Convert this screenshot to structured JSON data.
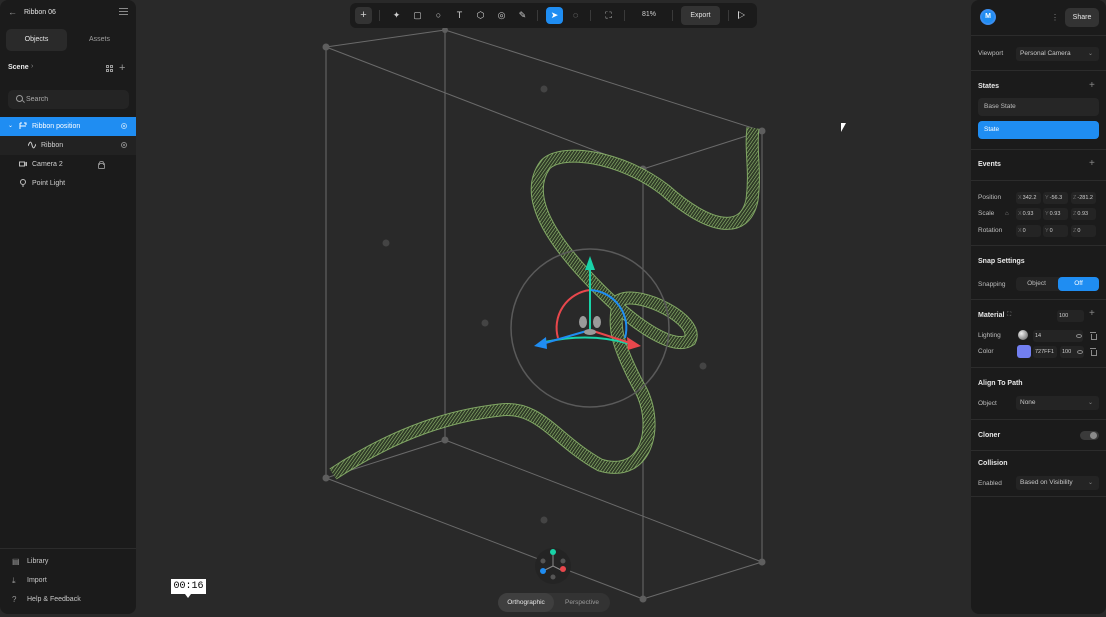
{
  "project": {
    "title": "Ribbon 06"
  },
  "left_panel": {
    "tabs": [
      {
        "label": "Objects"
      },
      {
        "label": "Assets"
      }
    ],
    "scene_label": "Scene",
    "search_placeholder": "Search",
    "layers": [
      {
        "name": "Ribbon position",
        "icon": "group-icon"
      },
      {
        "name": "Ribbon",
        "icon": "path-icon"
      },
      {
        "name": "Camera 2",
        "icon": "camera-icon"
      },
      {
        "name": "Point Light",
        "icon": "lightbulb-icon"
      }
    ],
    "footer": [
      {
        "label": "Library",
        "icon": "library-icon"
      },
      {
        "label": "Import",
        "icon": "import-icon"
      },
      {
        "label": "Help & Feedback",
        "icon": "help-icon"
      }
    ]
  },
  "toolbar": {
    "zoom": "81%",
    "export_label": "Export"
  },
  "right_panel": {
    "avatar_initial": "M",
    "share_label": "Share",
    "viewport_label": "Viewport",
    "viewport_value": "Personal Camera",
    "states_title": "States",
    "states": [
      "Base State",
      "State"
    ],
    "events_title": "Events",
    "position_label": "Position",
    "position": {
      "x": "342.2",
      "y": "-56.3",
      "z": "-281.2"
    },
    "scale_label": "Scale",
    "scale": {
      "x": "0.93",
      "y": "0.93",
      "z": "0.93"
    },
    "rotation_label": "Rotation",
    "rotation": {
      "x": "0",
      "y": "0",
      "z": "0"
    },
    "snap_title": "Snap Settings",
    "snapping_label": "Snapping",
    "snapping_options": [
      "Object",
      "Off"
    ],
    "material_title": "Material",
    "material_opacity": "100",
    "lighting_label": "Lighting",
    "lighting_value": "14",
    "color_label": "Color",
    "color_hex": "727FF1",
    "color_opacity": "100",
    "color_swatch": "#727ff1",
    "align_title": "Align To Path",
    "object_label": "Object",
    "object_value": "None",
    "cloner_title": "Cloner",
    "collision_title": "Collision",
    "enabled_label": "Enabled",
    "enabled_value": "Based on Visibility"
  },
  "viewport": {
    "projection_options": [
      "Orthographic",
      "Perspective"
    ],
    "timestamp": "00:16"
  },
  "colors": {
    "accent": "#1f8df2",
    "ribbon": "#9dc97a",
    "gizmo_x": "#e8474c",
    "gizmo_y": "#19d3a8",
    "gizmo_z": "#1f8df2"
  }
}
